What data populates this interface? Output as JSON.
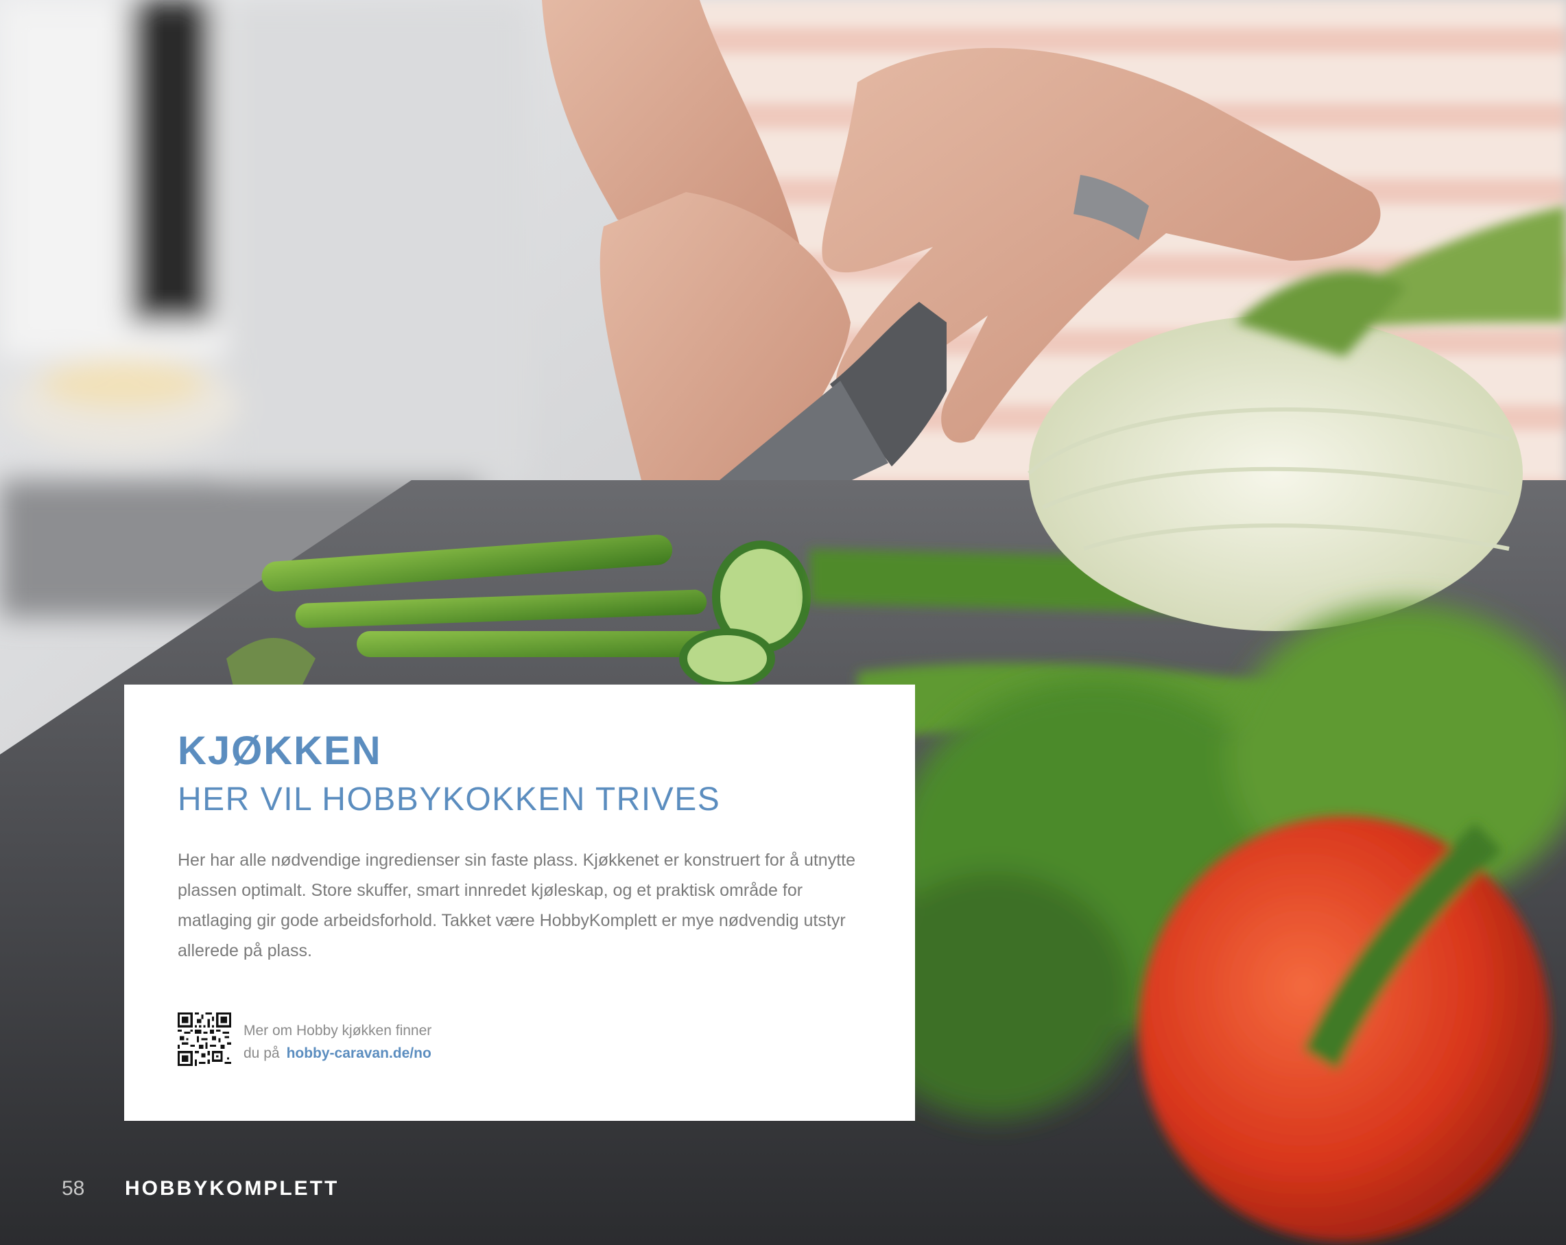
{
  "card": {
    "title": "KJØKKEN",
    "subtitle": "HER VIL HOBBYKOKKEN TRIVES",
    "body": "Her har alle nødvendige ingredienser sin faste plass. Kjøkkenet er konstruert for å utnytte plassen optimalt. Store skuffer, smart innredet kjøleskap, og et praktisk område for matlaging gir gode arbeidsforhold. Takket være HobbyKomplett er mye nødvendig utstyr allerede på plass.",
    "qr_line1": "Mer om Hobby kjøkken finner",
    "qr_line2_prefix": "du på",
    "qr_link": "hobby-caravan.de/no"
  },
  "footer": {
    "page_number": "58",
    "section": "HOBBYKOMPLETT"
  },
  "colors": {
    "accent": "#5b8dbf",
    "body_text": "#7a7a7a",
    "card_bg": "#ffffff"
  }
}
